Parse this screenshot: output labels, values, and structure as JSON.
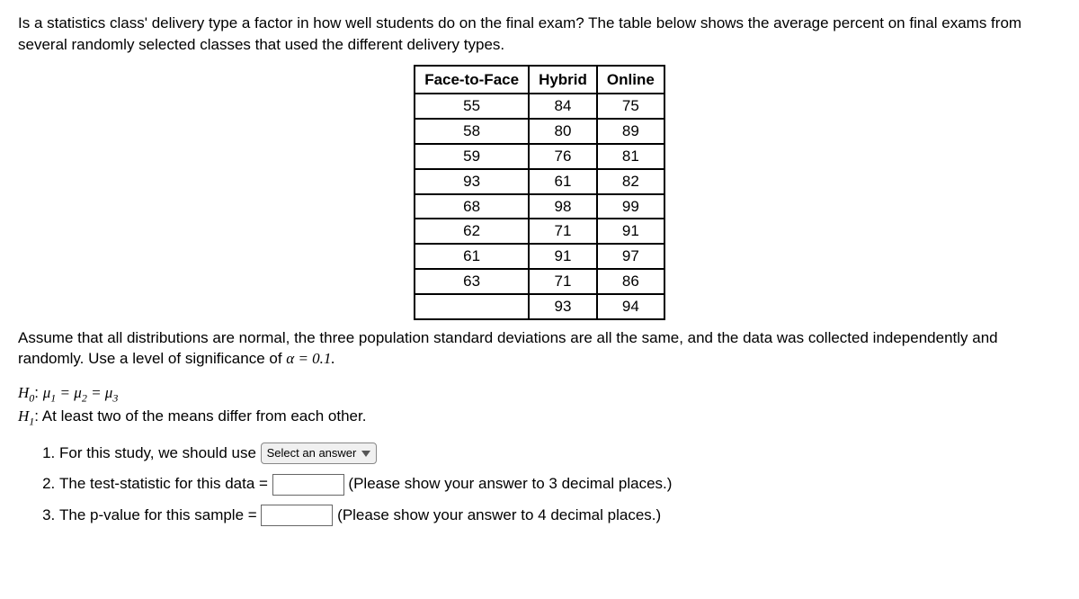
{
  "intro": "Is a statistics class' delivery type a factor in how well students do on the final exam? The table below shows the average percent on final exams from several randomly selected classes that used the different delivery types.",
  "table": {
    "headers": [
      "Face-to-Face",
      "Hybrid",
      "Online"
    ],
    "rows": [
      [
        "55",
        "84",
        "75"
      ],
      [
        "58",
        "80",
        "89"
      ],
      [
        "59",
        "76",
        "81"
      ],
      [
        "93",
        "61",
        "82"
      ],
      [
        "68",
        "98",
        "99"
      ],
      [
        "62",
        "71",
        "91"
      ],
      [
        "61",
        "91",
        "97"
      ],
      [
        "63",
        "71",
        "86"
      ],
      [
        "",
        "93",
        "94"
      ]
    ]
  },
  "assume_pre": "Assume that all distributions are normal, the three population standard deviations are all the same, and the data was collected independently and randomly. Use a level of significance of ",
  "alpha_eq": "α = 0.1.",
  "h0_label": "H",
  "h0_sub": "0",
  "h0_colon": ": ",
  "mu": "μ",
  "sub1": "1",
  "sub2": "2",
  "sub3": "3",
  "eq": " = ",
  "h1_label": "H",
  "h1_sub": "1",
  "h1_text": ": At least two of the means differ from each other.",
  "q1_pre": "For this study, we should use ",
  "q1_select": "Select an answer",
  "q2_pre": "The test-statistic for this data = ",
  "q2_post": " (Please show your answer to 3 decimal places.)",
  "q3_pre": "The p-value for this sample = ",
  "q3_post": " (Please show your answer to 4 decimal places.)"
}
